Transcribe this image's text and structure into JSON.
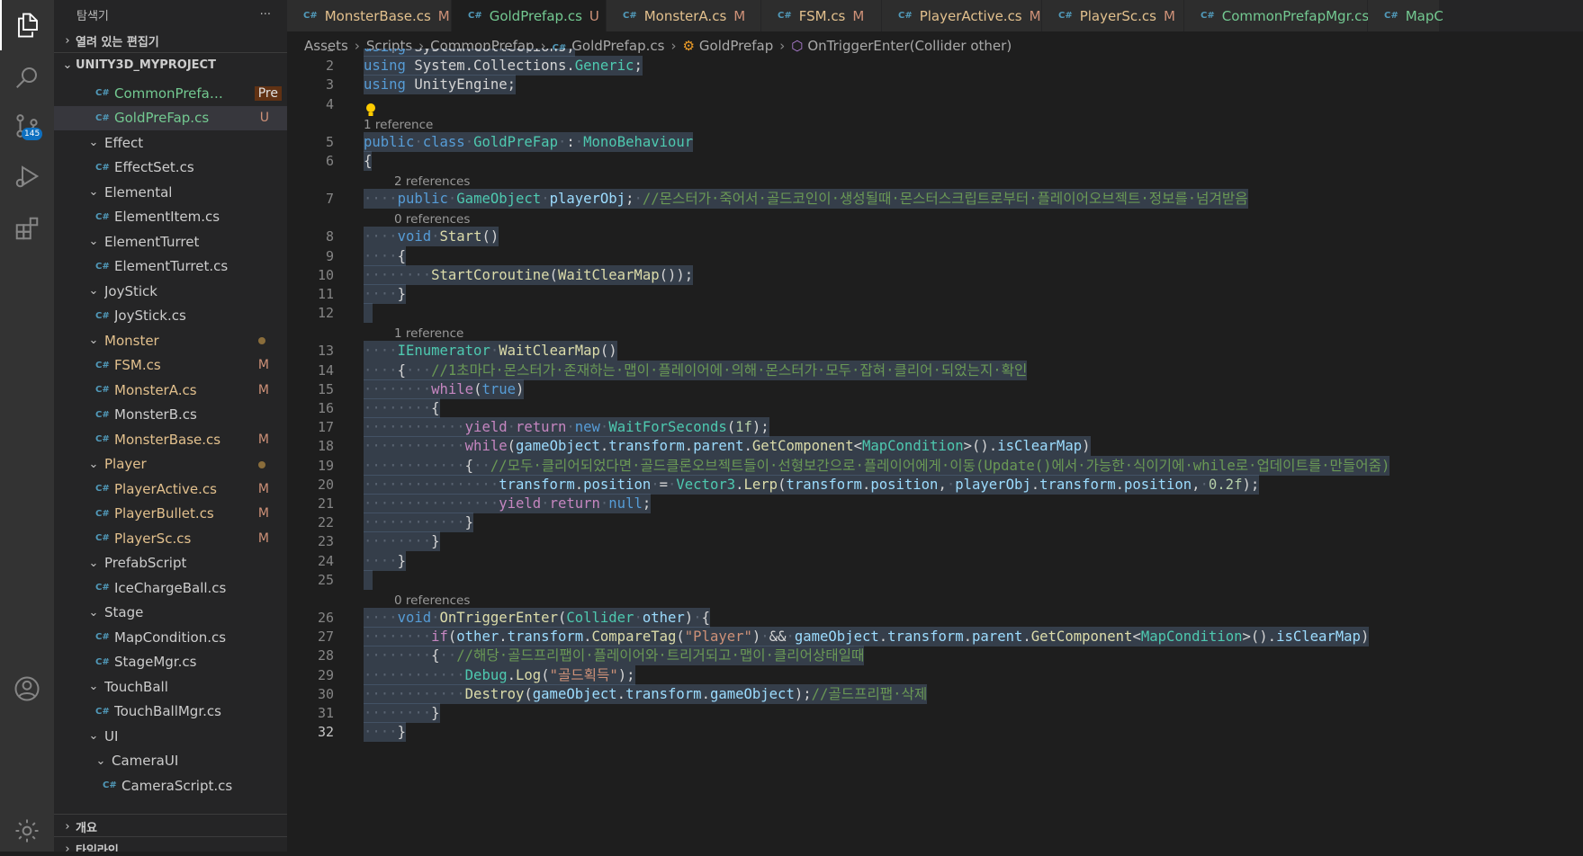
{
  "sidebar": {
    "title": "탐색기",
    "more": "···",
    "open_editors": "열려 있는 편집기",
    "project": "UNITY3D_MYPROJECT",
    "outline": "개요",
    "timeline": "타임라인",
    "items": [
      {
        "label": "CommonPrefapMgr.cs",
        "status": "Pre",
        "kind": "file",
        "depth": 2,
        "color": "untr"
      },
      {
        "label": "GoldPreFap.cs",
        "status": "U",
        "kind": "file",
        "depth": 2,
        "color": "untr",
        "selected": true
      },
      {
        "label": "Effect",
        "kind": "folder",
        "depth": 1
      },
      {
        "label": "EffectSet.cs",
        "kind": "file",
        "depth": 2
      },
      {
        "label": "Elemental",
        "kind": "folder",
        "depth": 1
      },
      {
        "label": "ElementItem.cs",
        "kind": "file",
        "depth": 2
      },
      {
        "label": "ElementTurret",
        "kind": "folder",
        "depth": 1
      },
      {
        "label": "ElementTurret.cs",
        "kind": "file",
        "depth": 2
      },
      {
        "label": "JoyStick",
        "kind": "folder",
        "depth": 1
      },
      {
        "label": "JoyStick.cs",
        "kind": "file",
        "depth": 2
      },
      {
        "label": "Monster",
        "kind": "folder",
        "depth": 1,
        "color": "mod",
        "dot": true
      },
      {
        "label": "FSM.cs",
        "status": "M",
        "kind": "file",
        "depth": 2,
        "color": "mod"
      },
      {
        "label": "MonsterA.cs",
        "status": "M",
        "kind": "file",
        "depth": 2,
        "color": "mod"
      },
      {
        "label": "MonsterB.cs",
        "kind": "file",
        "depth": 2
      },
      {
        "label": "MonsterBase.cs",
        "status": "M",
        "kind": "file",
        "depth": 2,
        "color": "mod"
      },
      {
        "label": "Player",
        "kind": "folder",
        "depth": 1,
        "color": "mod",
        "dot": true
      },
      {
        "label": "PlayerActive.cs",
        "status": "M",
        "kind": "file",
        "depth": 2,
        "color": "mod"
      },
      {
        "label": "PlayerBullet.cs",
        "status": "M",
        "kind": "file",
        "depth": 2,
        "color": "mod"
      },
      {
        "label": "PlayerSc.cs",
        "status": "M",
        "kind": "file",
        "depth": 2,
        "color": "mod"
      },
      {
        "label": "PrefabScript",
        "kind": "folder",
        "depth": 1
      },
      {
        "label": "IceChargeBall.cs",
        "kind": "file",
        "depth": 2
      },
      {
        "label": "Stage",
        "kind": "folder",
        "depth": 1
      },
      {
        "label": "MapCondition.cs",
        "kind": "file",
        "depth": 2
      },
      {
        "label": "StageMgr.cs",
        "kind": "file",
        "depth": 2
      },
      {
        "label": "TouchBall",
        "kind": "folder",
        "depth": 1
      },
      {
        "label": "TouchBallMgr.cs",
        "kind": "file",
        "depth": 2
      },
      {
        "label": "UI",
        "kind": "folder",
        "depth": 1
      },
      {
        "label": "CameraUI",
        "kind": "folder",
        "depth": 2
      },
      {
        "label": "CameraScript.cs",
        "kind": "file",
        "depth": 3
      }
    ]
  },
  "activity": {
    "source_control_badge": "145"
  },
  "tabs": [
    {
      "label": "MonsterBase.cs",
      "status": "M",
      "color": "mod"
    },
    {
      "label": "GoldPrefap.cs",
      "status": "U",
      "color": "untr",
      "active": true,
      "close": "✕"
    },
    {
      "label": "MonsterA.cs",
      "status": "M",
      "color": "mod"
    },
    {
      "label": "FSM.cs",
      "status": "M",
      "color": "mod"
    },
    {
      "label": "PlayerActive.cs",
      "status": "M",
      "color": "mod"
    },
    {
      "label": "PlayerSc.cs",
      "status": "M",
      "color": "mod"
    },
    {
      "label": "CommonPrefapMgr.cs",
      "status": "U",
      "color": "untr"
    },
    {
      "label": "MapC",
      "status": "",
      "color": "untr"
    }
  ],
  "breadcrumbs": [
    "Assets",
    "Scripts",
    "CommonPrefap",
    "GoldPrefap.cs",
    "GoldPrefap",
    "OnTriggerEnter(Collider other)"
  ],
  "code": {
    "current_line": 32,
    "lenses": [
      {
        "before": 5,
        "text": "1 reference"
      },
      {
        "before": 7,
        "text": "2 references"
      },
      {
        "before": 8,
        "text": "0 references"
      },
      {
        "before": 13,
        "text": "1 reference"
      },
      {
        "before": 26,
        "text": "0 references"
      }
    ],
    "lines": [
      [
        [
          "kw",
          "using"
        ],
        [
          "",
          " System.Collections;"
        ]
      ],
      [
        [
          "kw",
          "using"
        ],
        [
          "",
          " System.Collections."
        ],
        [
          "ty",
          "Generic"
        ],
        [
          "",
          ";"
        ]
      ],
      [
        [
          "kw",
          "using"
        ],
        [
          "",
          " UnityEngine;"
        ]
      ],
      [],
      [
        [
          "kw",
          "public"
        ],
        [
          "ws",
          "·"
        ],
        [
          "kw",
          "class"
        ],
        [
          "ws",
          "·"
        ],
        [
          "ty",
          "GoldPreFap"
        ],
        [
          "ws",
          "·"
        ],
        [
          "",
          ":"
        ],
        [
          "ws",
          "·"
        ],
        [
          "ty",
          "MonoBehaviour"
        ]
      ],
      [
        [
          "",
          "{"
        ]
      ],
      [
        [
          "ws",
          "····"
        ],
        [
          "kw",
          "public"
        ],
        [
          "ws",
          "·"
        ],
        [
          "ty",
          "GameObject"
        ],
        [
          "ws",
          "·"
        ],
        [
          "va",
          "playerObj"
        ],
        [
          "",
          ";"
        ],
        [
          "ws",
          "·"
        ],
        [
          "cm",
          "//몬스터가·죽어서·골드코인이·생성될때·몬스터스크립트로부터·플레이어오브젝트·정보를·넘겨받음"
        ]
      ],
      [
        [
          "ws",
          "····"
        ],
        [
          "kw",
          "void"
        ],
        [
          "ws",
          "·"
        ],
        [
          "fn",
          "Start"
        ],
        [
          "",
          "()"
        ]
      ],
      [
        [
          "ws",
          "····"
        ],
        [
          "",
          "{"
        ]
      ],
      [
        [
          "ws",
          "········"
        ],
        [
          "fn",
          "StartCoroutine"
        ],
        [
          "",
          "("
        ],
        [
          "fn",
          "WaitClearMap"
        ],
        [
          "",
          "());"
        ]
      ],
      [
        [
          "ws",
          "····"
        ],
        [
          "",
          "}"
        ]
      ],
      [],
      [
        [
          "ws",
          "····"
        ],
        [
          "ty",
          "IEnumerator"
        ],
        [
          "ws",
          "·"
        ],
        [
          "fn",
          "WaitClearMap"
        ],
        [
          "",
          "()"
        ]
      ],
      [
        [
          "ws",
          "····"
        ],
        [
          "",
          "{"
        ],
        [
          "ws",
          "···"
        ],
        [
          "cm",
          "//1초마다·몬스터가·존재하는·맵이·플레이어에·의해·몬스터가·모두·잡혀·클리어·되었는지·확인"
        ]
      ],
      [
        [
          "ws",
          "········"
        ],
        [
          "kc",
          "while"
        ],
        [
          "",
          "("
        ],
        [
          "kw",
          "true"
        ],
        [
          "",
          ")"
        ]
      ],
      [
        [
          "ws",
          "········"
        ],
        [
          "",
          "{"
        ]
      ],
      [
        [
          "ws",
          "············"
        ],
        [
          "kc",
          "yield"
        ],
        [
          "ws",
          "·"
        ],
        [
          "kc",
          "return"
        ],
        [
          "ws",
          "·"
        ],
        [
          "kw",
          "new"
        ],
        [
          "ws",
          "·"
        ],
        [
          "ty",
          "WaitForSeconds"
        ],
        [
          "",
          "("
        ],
        [
          "nu",
          "1f"
        ],
        [
          "",
          ");"
        ]
      ],
      [
        [
          "ws",
          "············"
        ],
        [
          "kc",
          "while"
        ],
        [
          "",
          "("
        ],
        [
          "va",
          "gameObject"
        ],
        [
          "",
          "."
        ],
        [
          "va",
          "transform"
        ],
        [
          "",
          "."
        ],
        [
          "va",
          "parent"
        ],
        [
          "",
          "."
        ],
        [
          "fn",
          "GetComponent"
        ],
        [
          "",
          "<"
        ],
        [
          "ty",
          "MapCondition"
        ],
        [
          "",
          ">()."
        ],
        [
          "va",
          "isClearMap"
        ],
        [
          "",
          ")"
        ]
      ],
      [
        [
          "ws",
          "············"
        ],
        [
          "",
          "{"
        ],
        [
          "ws",
          "··"
        ],
        [
          "cm",
          "//모두·클리어되었다면·골드클론오브젝트들이·선형보간으로·플레이어에게·이동(Update()에서·가능한·식이기에·while로·업데이트를·만들어줌)"
        ]
      ],
      [
        [
          "ws",
          "················"
        ],
        [
          "va",
          "transform"
        ],
        [
          "",
          "."
        ],
        [
          "va",
          "position"
        ],
        [
          "ws",
          "·"
        ],
        [
          "",
          "="
        ],
        [
          "ws",
          "·"
        ],
        [
          "ty",
          "Vector3"
        ],
        [
          "",
          "."
        ],
        [
          "fn",
          "Lerp"
        ],
        [
          "",
          "("
        ],
        [
          "va",
          "transform"
        ],
        [
          "",
          "."
        ],
        [
          "va",
          "position"
        ],
        [
          "",
          ","
        ],
        [
          "ws",
          "·"
        ],
        [
          "va",
          "playerObj"
        ],
        [
          "",
          "."
        ],
        [
          "va",
          "transform"
        ],
        [
          "",
          "."
        ],
        [
          "va",
          "position"
        ],
        [
          "",
          ","
        ],
        [
          "ws",
          "·"
        ],
        [
          "nu",
          "0.2f"
        ],
        [
          "",
          ");"
        ]
      ],
      [
        [
          "ws",
          "················"
        ],
        [
          "kc",
          "yield"
        ],
        [
          "ws",
          "·"
        ],
        [
          "kc",
          "return"
        ],
        [
          "ws",
          "·"
        ],
        [
          "kw",
          "null"
        ],
        [
          "",
          ";"
        ]
      ],
      [
        [
          "ws",
          "············"
        ],
        [
          "",
          "}"
        ]
      ],
      [
        [
          "ws",
          "········"
        ],
        [
          "",
          "}"
        ]
      ],
      [
        [
          "ws",
          "····"
        ],
        [
          "",
          "}"
        ]
      ],
      [],
      [
        [
          "ws",
          "····"
        ],
        [
          "kw",
          "void"
        ],
        [
          "ws",
          "·"
        ],
        [
          "fn",
          "OnTriggerEnter"
        ],
        [
          "",
          "("
        ],
        [
          "ty",
          "Collider"
        ],
        [
          "ws",
          "·"
        ],
        [
          "va",
          "other"
        ],
        [
          "",
          ")"
        ],
        [
          "ws",
          "·"
        ],
        [
          "",
          "{"
        ]
      ],
      [
        [
          "ws",
          "········"
        ],
        [
          "kc",
          "if"
        ],
        [
          "",
          "("
        ],
        [
          "va",
          "other"
        ],
        [
          "",
          "."
        ],
        [
          "va",
          "transform"
        ],
        [
          "",
          "."
        ],
        [
          "fn",
          "CompareTag"
        ],
        [
          "",
          "("
        ],
        [
          "st",
          "\"Player\""
        ],
        [
          "",
          ")"
        ],
        [
          "ws",
          "·"
        ],
        [
          "",
          "&&"
        ],
        [
          "ws",
          "·"
        ],
        [
          "va",
          "gameObject"
        ],
        [
          "",
          "."
        ],
        [
          "va",
          "transform"
        ],
        [
          "",
          "."
        ],
        [
          "va",
          "parent"
        ],
        [
          "",
          "."
        ],
        [
          "fn",
          "GetComponent"
        ],
        [
          "",
          "<"
        ],
        [
          "ty",
          "MapCondition"
        ],
        [
          "",
          ">()."
        ],
        [
          "va",
          "isClearMap"
        ],
        [
          "",
          ")"
        ]
      ],
      [
        [
          "ws",
          "········"
        ],
        [
          "",
          "{"
        ],
        [
          "ws",
          "··"
        ],
        [
          "cm",
          "//해당·골드프리팹이·플레이어와·트리거되고·맵이·클리어상태일때"
        ]
      ],
      [
        [
          "ws",
          "············"
        ],
        [
          "ty",
          "Debug"
        ],
        [
          "",
          "."
        ],
        [
          "fn",
          "Log"
        ],
        [
          "",
          "("
        ],
        [
          "st",
          "\"골드획득\""
        ],
        [
          "",
          ");"
        ]
      ],
      [
        [
          "ws",
          "············"
        ],
        [
          "fn",
          "Destroy"
        ],
        [
          "",
          "("
        ],
        [
          "va",
          "gameObject"
        ],
        [
          "",
          "."
        ],
        [
          "va",
          "transform"
        ],
        [
          "",
          "."
        ],
        [
          "va",
          "gameObject"
        ],
        [
          "",
          ");"
        ],
        [
          "cm",
          "//골드프리팹·삭제"
        ]
      ],
      [
        [
          "ws",
          "········"
        ],
        [
          "",
          "}"
        ]
      ],
      [
        [
          "ws",
          "····"
        ],
        [
          "",
          "}"
        ]
      ]
    ]
  }
}
